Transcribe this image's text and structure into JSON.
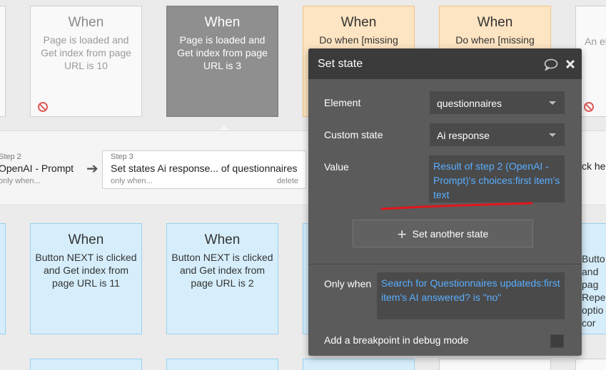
{
  "cards_top": [
    {
      "title": "When",
      "desc": "Page is loaded and Get index from page URL is 10"
    },
    {
      "title": "When",
      "desc": "Page is loaded and Get index from page URL is 3"
    },
    {
      "title": "When",
      "desc": "Do when [missing"
    },
    {
      "title": "When",
      "desc": "Do when [missing"
    },
    {
      "title": "",
      "desc": "An el"
    }
  ],
  "workflow": {
    "step2_label": "Step 2",
    "step2_title": "OpenAI - Prompt",
    "step2_only": "only when...",
    "step3_label": "Step 3",
    "step3_title": "Set states Ai response... of questionnaires",
    "step3_only": "only when...",
    "step3_delete": "delete",
    "right_text": "ck he"
  },
  "modal": {
    "title": "Set state",
    "element_label": "Element",
    "element_value": "questionnaires",
    "custom_state_label": "Custom state",
    "custom_state_value": "Ai response",
    "value_label": "Value",
    "value_expr": "Result of step 2 (OpenAI - Prompt)'s choices:first item's text",
    "set_another_label": "Set another state",
    "only_when_label": "Only when",
    "only_when_expr": "Search for Questionnaires updateds:first item's AI answered? is \"no\"",
    "breakpoint_label": "Add a breakpoint in debug mode"
  },
  "cards_bottom": [
    {
      "title": "When",
      "desc": "Button NEXT is clicked and Get index from page URL is 11"
    },
    {
      "title": "When",
      "desc": "Button NEXT is clicked and Get index from page URL is 2"
    },
    {
      "title": "",
      "desc": "Butto and pag Repe optio cor"
    }
  ],
  "colors": {
    "accent_link": "#5aaeff",
    "annotation": "#e0161b"
  },
  "icons": [
    "ban-icon",
    "comment-icon",
    "close-icon",
    "chevron-down-icon",
    "arrow-right-icon",
    "plus-icon"
  ]
}
